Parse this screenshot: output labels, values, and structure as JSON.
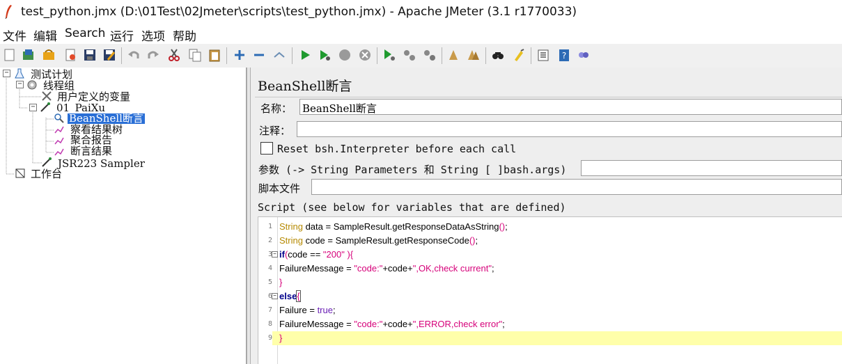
{
  "window": {
    "title": "test_python.jmx (D:\\01Test\\02Jmeter\\scripts\\test_python.jmx) - Apache JMeter (3.1 r1770033)"
  },
  "menu": [
    "文件",
    "编辑",
    "Search",
    "运行",
    "选项",
    "帮助"
  ],
  "toolbar": {
    "icons": [
      "new-icon",
      "templates-icon",
      "open-icon",
      "close-icon",
      "save-icon",
      "save-as-icon",
      "undo-icon",
      "redo-icon",
      "cut-icon",
      "copy-icon",
      "paste-icon",
      "expand-icon",
      "collapse-icon",
      "toggle-icon",
      "start-icon",
      "start-no-pause-icon",
      "stop-icon",
      "shutdown-icon",
      "remote-start-icon",
      "remote-stop-icon",
      "remote-shutdown-icon",
      "clear-icon",
      "clear-all-icon",
      "search-icon",
      "reset-search-icon",
      "function-helper-icon",
      "help-icon",
      "log-icon"
    ]
  },
  "tree": {
    "items": [
      {
        "label": "测试计划",
        "level": 0
      },
      {
        "label": "线程组",
        "level": 1
      },
      {
        "label": "用户定义的变量",
        "level": 2
      },
      {
        "label": "01_PaiXu",
        "level": 2
      },
      {
        "label": "BeanShell断言",
        "level": 3,
        "selected": true
      },
      {
        "label": "察看结果树",
        "level": 3
      },
      {
        "label": "聚合报告",
        "level": 3
      },
      {
        "label": "断言结果",
        "level": 3
      },
      {
        "label": "JSR223 Sampler",
        "level": 2
      },
      {
        "label": "工作台",
        "level": 0
      }
    ]
  },
  "panel": {
    "title": "BeanShell断言",
    "name_label": "名称：",
    "name_value": "BeanShell断言",
    "comment_label": "注释：",
    "comment_value": "",
    "reset_label": "Reset bsh.Interpreter before each call",
    "reset_checked": false,
    "params_label": "参数 (-> String Parameters 和 String [ ]bash.args)",
    "params_value": "",
    "file_label": "脚本文件",
    "file_value": "",
    "script_label": "Script (see below for variables that are defined)"
  },
  "script_lines": [
    {
      "n": "1",
      "text": "String data = SampleResult.getResponseDataAsString();"
    },
    {
      "n": "2",
      "text": "String code = SampleResult.getResponseCode();"
    },
    {
      "n": "3",
      "text": "if(code == \"200\" ){"
    },
    {
      "n": "4",
      "text": "FailureMessage = \"code:\"+code+\",OK,check current\";"
    },
    {
      "n": "5",
      "text": "}"
    },
    {
      "n": "6",
      "text": "else{"
    },
    {
      "n": "7",
      "text": "Failure = true;"
    },
    {
      "n": "8",
      "text": "FailureMessage = \"code:\"+code+\",ERROR,check error\";"
    },
    {
      "n": "9",
      "text": "}"
    }
  ],
  "colors": {
    "selection": "#2a6fd6",
    "current_line": "#ffffaa",
    "keyword": "#b58900",
    "string": "#d6007a"
  }
}
